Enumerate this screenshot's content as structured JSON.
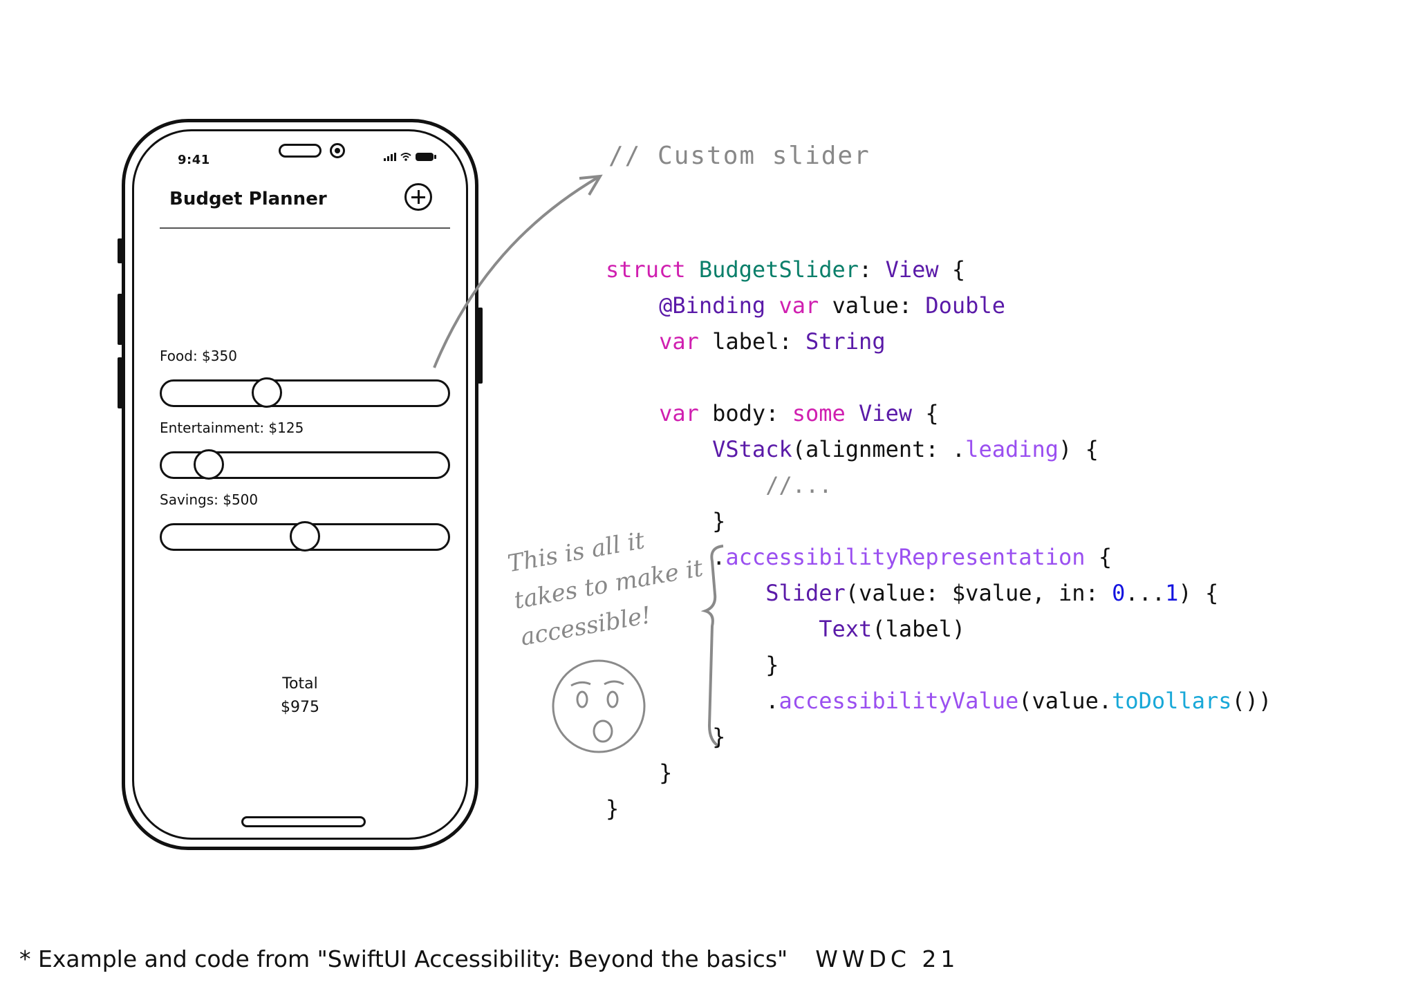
{
  "annotation": {
    "code_caption": "// Custom slider",
    "handwritten_note": [
      "This is all it",
      "takes to make it",
      "accessible!"
    ],
    "footnote_text": "* Example and code from \"SwiftUI Accessibility: Beyond the basics\"",
    "footnote_event": "WWDC 21"
  },
  "phone": {
    "status_time": "9:41",
    "icons": {
      "signal": "cell-signal-icon",
      "wifi": "wifi-icon",
      "battery": "battery-icon",
      "add": "plus-circle-icon"
    },
    "nav_title": "Budget Planner",
    "sliders": [
      {
        "label": "Food: $350",
        "value": 0.35
      },
      {
        "label": "Entertainment: $125",
        "value": 0.125
      },
      {
        "label": "Savings: $500",
        "value": 0.5
      }
    ],
    "total_label": "Total",
    "total_value": "$975"
  },
  "code": {
    "lines": [
      [
        [
          "kw",
          "struct"
        ],
        [
          "",
          " "
        ],
        [
          "teal",
          "BudgetSlider"
        ],
        [
          "",
          ": "
        ],
        [
          "type",
          "View"
        ],
        [
          "",
          " {"
        ]
      ],
      [
        [
          "",
          "    "
        ],
        [
          "type",
          "@Binding"
        ],
        [
          "",
          " "
        ],
        [
          "kw",
          "var"
        ],
        [
          "",
          " value: "
        ],
        [
          "type",
          "Double"
        ]
      ],
      [
        [
          "",
          "    "
        ],
        [
          "kw",
          "var"
        ],
        [
          "",
          " label: "
        ],
        [
          "type",
          "String"
        ]
      ],
      [
        [
          "",
          ""
        ]
      ],
      [
        [
          "",
          "    "
        ],
        [
          "kw",
          "var"
        ],
        [
          "",
          " body: "
        ],
        [
          "kw",
          "some"
        ],
        [
          "",
          " "
        ],
        [
          "type",
          "View"
        ],
        [
          "",
          " {"
        ]
      ],
      [
        [
          "",
          "        "
        ],
        [
          "type",
          "VStack"
        ],
        [
          "",
          "(alignment: ."
        ],
        [
          "fn",
          "leading"
        ],
        [
          "",
          ") {"
        ]
      ],
      [
        [
          "",
          "            "
        ],
        [
          "cmt",
          "//..."
        ]
      ],
      [
        [
          "",
          "        }"
        ]
      ],
      [
        [
          "",
          "        ."
        ],
        [
          "fn",
          "accessibilityRepresentation"
        ],
        [
          "",
          " {"
        ]
      ],
      [
        [
          "",
          "            "
        ],
        [
          "type",
          "Slider"
        ],
        [
          "",
          "(value: $value, in: "
        ],
        [
          "num",
          "0"
        ],
        [
          "",
          "..."
        ],
        [
          "num",
          "1"
        ],
        [
          "",
          ") {"
        ]
      ],
      [
        [
          "",
          "                "
        ],
        [
          "type",
          "Text"
        ],
        [
          "",
          "(label)"
        ]
      ],
      [
        [
          "",
          "            }"
        ]
      ],
      [
        [
          "",
          "            ."
        ],
        [
          "fn",
          "accessibilityValue"
        ],
        [
          "",
          "(value."
        ],
        [
          "cyan",
          "toDollars"
        ],
        [
          "",
          "())"
        ]
      ],
      [
        [
          "",
          "        }"
        ]
      ],
      [
        [
          "",
          "    }"
        ]
      ],
      [
        [
          "",
          "}"
        ]
      ]
    ]
  },
  "colors": {
    "keyword": "#d01fb0",
    "type": "#5a1aa8",
    "method": "#9a4ff0",
    "struct_name": "#0a7f6a",
    "number": "#1414e0",
    "call": "#18a8d8",
    "sketch_gray": "#888888"
  }
}
